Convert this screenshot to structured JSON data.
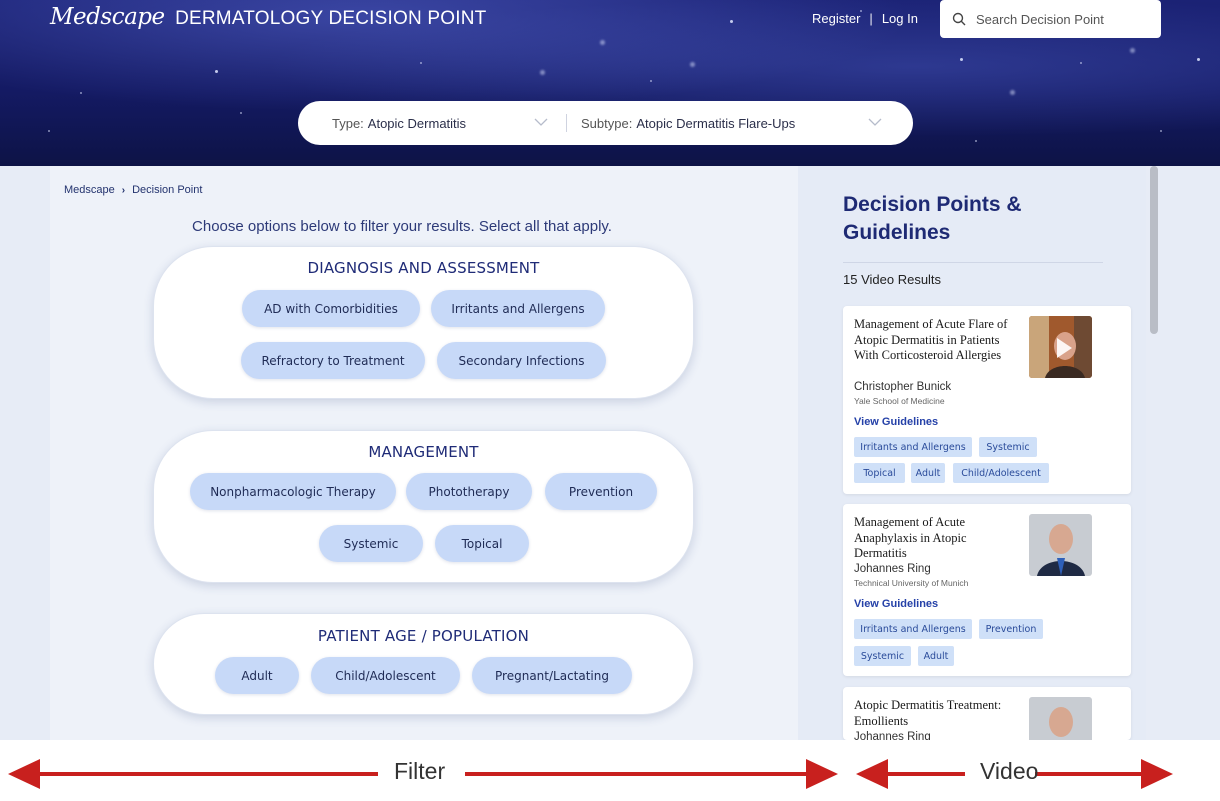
{
  "header": {
    "logo_text": "Medscape",
    "product_title": "DERMATOLOGY DECISION POINT",
    "register_label": "Register",
    "login_label": "Log In",
    "search_placeholder": "Search Decision Point",
    "type_label": "Type:",
    "type_value": "Atopic Dermatitis",
    "subtype_label": "Subtype:",
    "subtype_value": "Atopic Dermatitis Flare-Ups"
  },
  "breadcrumb": {
    "items": [
      "Medscape",
      "Decision Point"
    ]
  },
  "filter": {
    "instructions": "Choose options below to filter your results. Select all that apply.",
    "groups": [
      {
        "title": "DIAGNOSIS AND ASSESSMENT",
        "options": [
          "AD with Comorbidities",
          "Irritants and Allergens",
          "Refractory to Treatment",
          "Secondary Infections"
        ]
      },
      {
        "title": "MANAGEMENT",
        "options": [
          "Nonpharmacologic Therapy",
          "Phototherapy",
          "Prevention",
          "Systemic",
          "Topical"
        ]
      },
      {
        "title": "PATIENT AGE / POPULATION",
        "options": [
          "Adult",
          "Child/Adolescent",
          "Pregnant/Lactating"
        ]
      }
    ]
  },
  "results": {
    "title": "Decision Points & Guidelines",
    "count_text": "15 Video Results",
    "cards": [
      {
        "title": "Management of Acute Flare of Atopic Dermatitis in Patients With Corticosteroid Allergies",
        "author": "Christopher Bunick",
        "institution": "Yale School of Medicine",
        "link_label": "View Guidelines",
        "tags": [
          "Irritants and Allergens",
          "Systemic",
          "Topical",
          "Adult",
          "Child/Adolescent"
        ]
      },
      {
        "title": "Management of Acute Anaphylaxis in Atopic Dermatitis",
        "author": "Johannes Ring",
        "institution": "Technical University of Munich",
        "link_label": "View Guidelines",
        "tags": [
          "Irritants and Allergens",
          "Prevention",
          "Systemic",
          "Adult"
        ]
      },
      {
        "title": "Atopic Dermatitis Treatment: Emollients",
        "author": "Johannes Ring"
      }
    ]
  },
  "annotation": {
    "left_label": "Filter",
    "right_label": "Video"
  },
  "colors": {
    "accent_navy": "#1e2a74",
    "pill_bg": "#c7d9f8",
    "tag_bg": "#cfe0f8",
    "arrow_red": "#c8201e"
  }
}
